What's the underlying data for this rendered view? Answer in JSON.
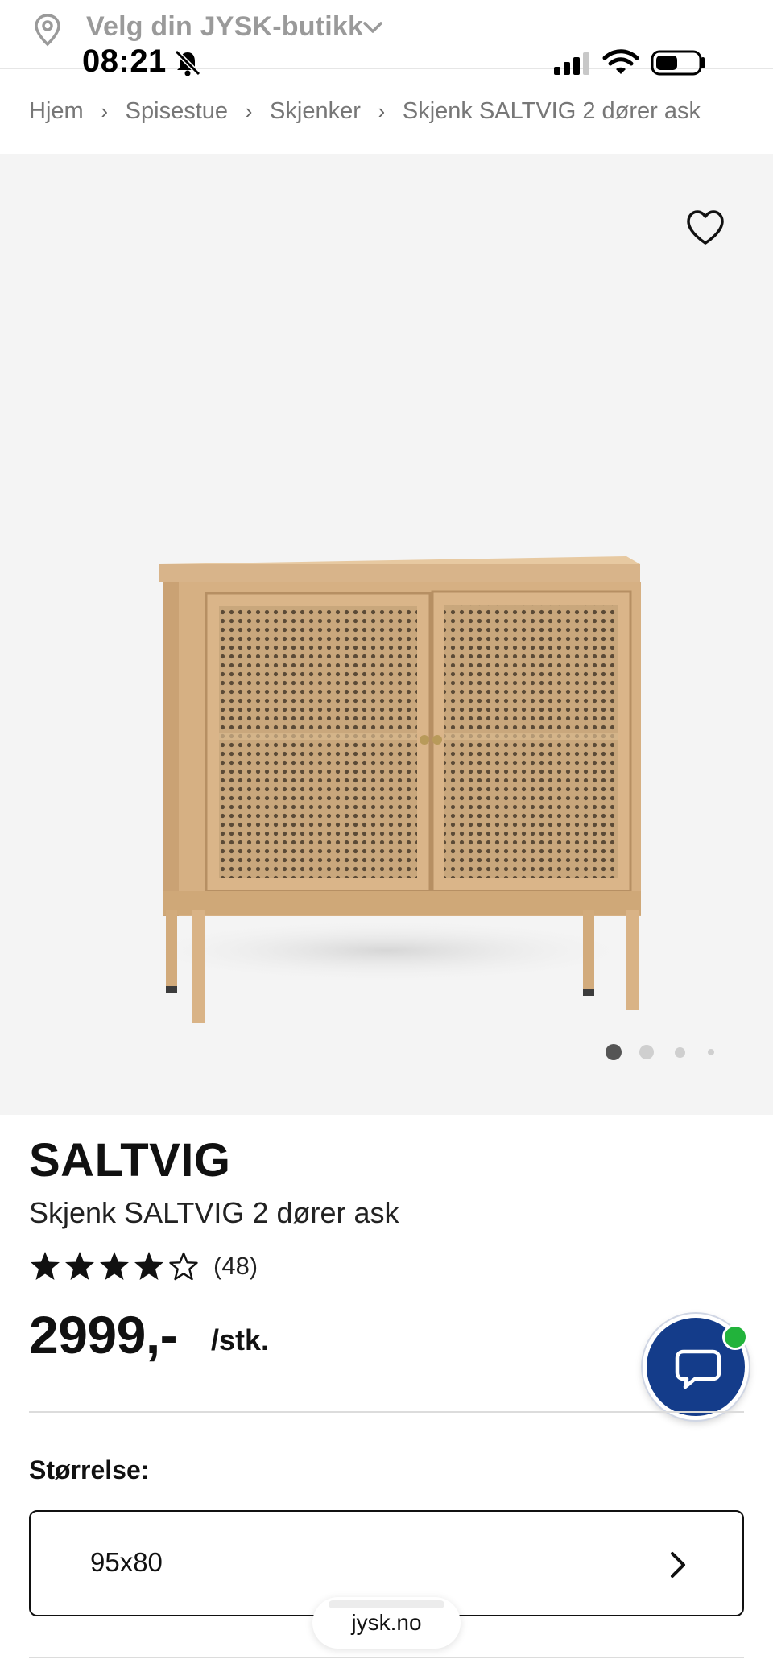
{
  "store_header": {
    "store_prompt": "Velg din JYSK-butikk",
    "pin_icon": "location-pin-icon",
    "chevron_icon": "chevron-down-icon"
  },
  "status_bar": {
    "time": "08:21",
    "bell_icon": "bell-muted-icon",
    "signal_icon": "cellular-signal-icon",
    "wifi_icon": "wifi-icon",
    "battery_icon": "battery-icon"
  },
  "breadcrumb": {
    "items": [
      "Hjem",
      "Spisestue",
      "Skjenker",
      "Skjenk SALTVIG 2 dører ask"
    ],
    "separator": "›"
  },
  "gallery": {
    "favorite_icon": "heart-outline-icon",
    "image_count": 4,
    "active_index": 0
  },
  "product": {
    "brand": "SALTVIG",
    "name": "Skjenk SALTVIG 2 dører ask",
    "rating": 4,
    "rating_max": 5,
    "review_count": "(48)",
    "price": "2999,-",
    "unit": "/stk."
  },
  "size": {
    "label": "Størrelse:",
    "value": "95x80",
    "chevron_icon": "chevron-right-icon"
  },
  "chat": {
    "icon": "chat-bubble-icon",
    "online_color": "#22b33b",
    "button_color": "#143c8a"
  },
  "browser": {
    "url": "jysk.no"
  },
  "colors": {
    "gallery_bg": "#f4f4f4",
    "muted_text": "#9a9a9a"
  }
}
